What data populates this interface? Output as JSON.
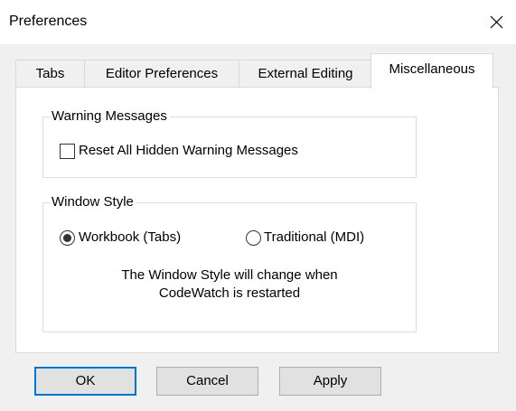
{
  "dialog": {
    "title": "Preferences",
    "close_icon": "close-icon"
  },
  "tabs": [
    {
      "label": "Tabs",
      "active": false
    },
    {
      "label": "Editor Preferences",
      "active": false
    },
    {
      "label": "External Editing",
      "active": false
    },
    {
      "label": "Miscellaneous",
      "active": true
    }
  ],
  "warning_group": {
    "title": "Warning Messages",
    "checkbox_label": "Reset All Hidden Warning Messages",
    "checked": false
  },
  "window_style_group": {
    "title": "Window Style",
    "options": [
      {
        "label": "Workbook (Tabs)",
        "selected": true
      },
      {
        "label": "Traditional (MDI)",
        "selected": false
      }
    ],
    "note_line1": "The Window Style will change when",
    "note_line2": "CodeWatch is restarted"
  },
  "buttons": {
    "ok": "OK",
    "cancel": "Cancel",
    "apply": "Apply"
  },
  "colors": {
    "default_button_border": "#0078d7",
    "dialog_background": "#f0f0f0"
  }
}
